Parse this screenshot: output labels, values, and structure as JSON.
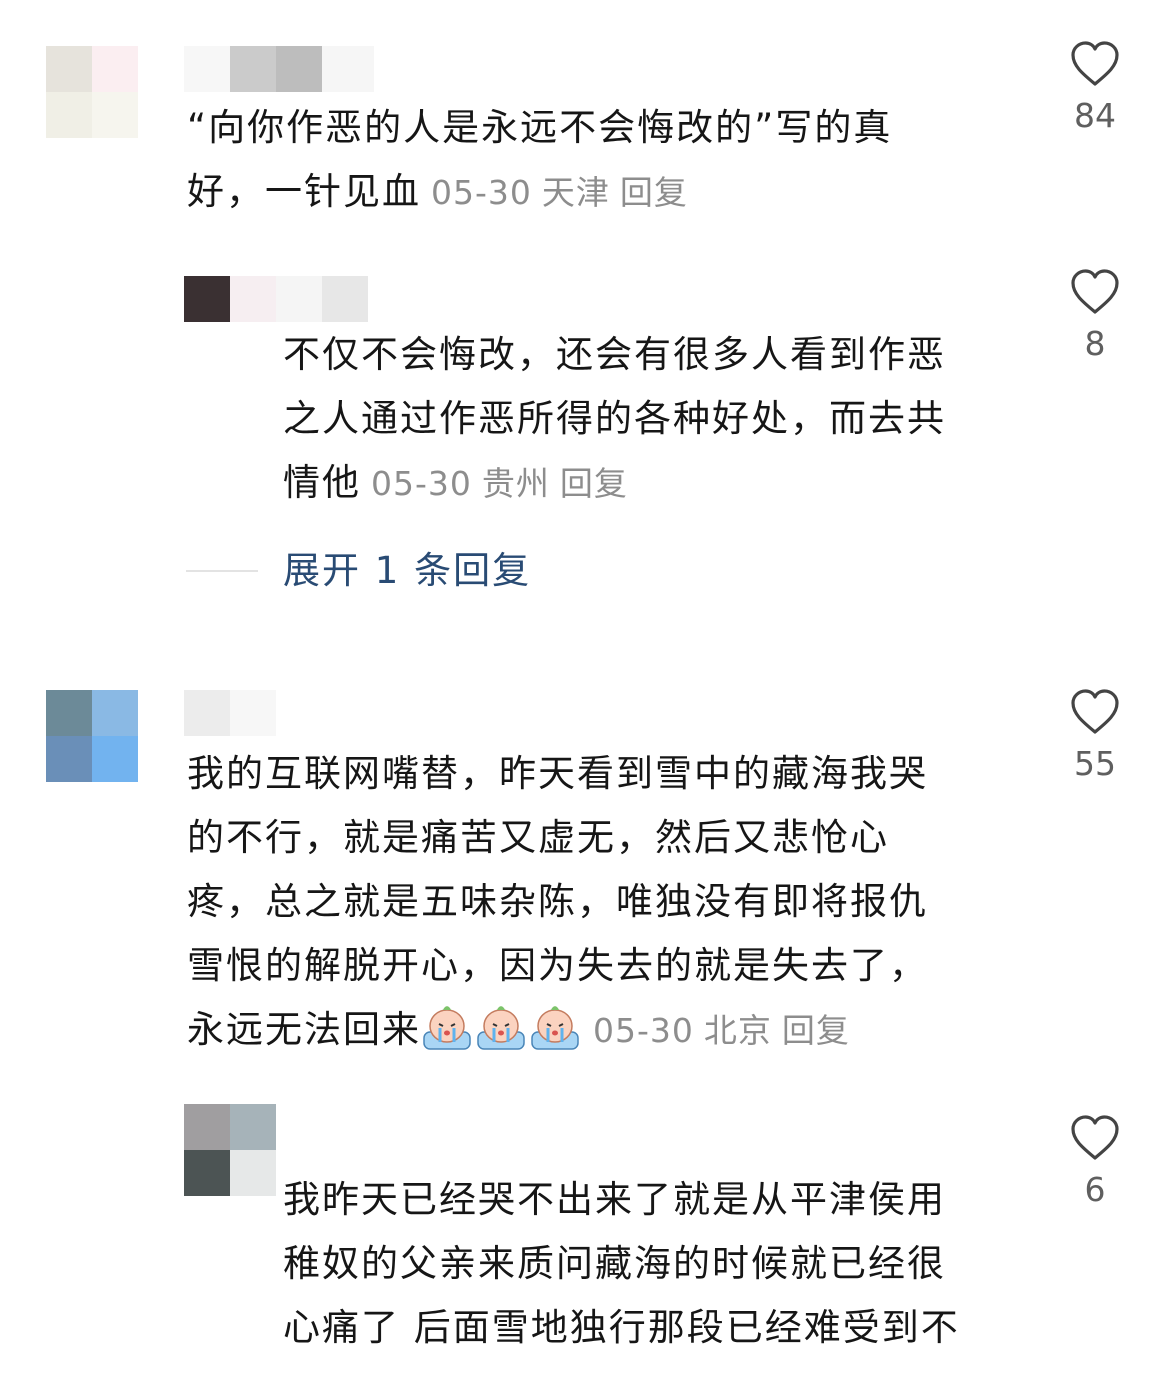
{
  "comments": [
    {
      "text_lines": [
        "“向你作恶的人是永远不会悔改的”写的真",
        "好，一针见血"
      ],
      "date": "05-30",
      "location": "天津",
      "reply_label": "回复",
      "likes": "84",
      "replies": [
        {
          "text_lines": [
            "不仅不会悔改，还会有很多人看到作恶",
            "之人通过作恶所得的各种好处，而去共",
            "情他"
          ],
          "date": "05-30",
          "location": "贵州",
          "reply_label": "回复",
          "likes": "8"
        }
      ],
      "expand_label": "展开 1 条回复"
    },
    {
      "text_lines": [
        "我的互联网嘴替，昨天看到雪中的藏海我哭",
        "的不行，就是痛苦又虚无，然后又悲怆心",
        "疼，总之就是五味杂陈，唯独没有即将报仇",
        "雪恨的解脱开心，因为失去的就是失去了，",
        "永远无法回来"
      ],
      "emoji_icons": [
        "crying-face-icon",
        "crying-face-icon",
        "crying-face-icon"
      ],
      "date": "05-30",
      "location": "北京",
      "reply_label": "回复",
      "likes": "55",
      "replies": [
        {
          "text_lines": [
            "我昨天已经哭不出来了就是从平津侯用",
            "稚奴的父亲来质问藏海的时候就已经很",
            "心痛了 后面雪地独行那段已经难受到不"
          ],
          "likes": "6"
        }
      ]
    }
  ],
  "colors": {
    "text": "#161616",
    "meta": "#8d8d8d",
    "link": "#294b74",
    "like_count": "#5f5f5f"
  }
}
